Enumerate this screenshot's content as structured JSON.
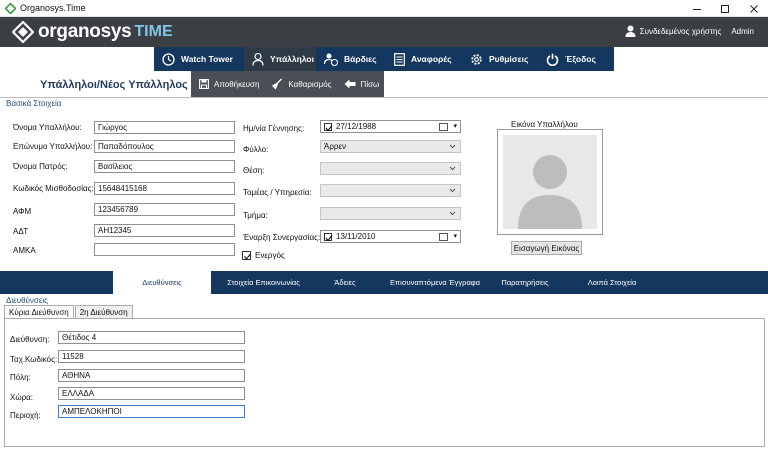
{
  "window": {
    "title": "Organosys.Time"
  },
  "header": {
    "logo_text": "organosys",
    "logo_suffix": "TIME",
    "user_label": "Συνδεδεμένος χρήστης",
    "user_name": "Admin"
  },
  "nav": {
    "items": [
      {
        "label": "Watch Tower",
        "icon": "clock-icon"
      },
      {
        "label": "Υπάλληλοι",
        "icon": "person-icon"
      },
      {
        "label": "Βάρδιες",
        "icon": "schedule-icon"
      },
      {
        "label": "Αναφορές",
        "icon": "report-icon"
      },
      {
        "label": "Ρυθμίσεις",
        "icon": "gear-icon"
      },
      {
        "label": "Έξοδος",
        "icon": "power-icon"
      }
    ]
  },
  "page": {
    "title": "Υπάλληλοι/Νέος Υπάλληλος",
    "toolbar": {
      "save": "Αποθήκευση",
      "clear": "Καθαρισμός",
      "back": "Πίσω"
    },
    "section_label": "Βασικά Στοιχεία"
  },
  "form": {
    "first_name": {
      "label": "Όνομα Υπαλλήλου:",
      "value": "Γιώργος"
    },
    "last_name": {
      "label": "Επώνυμο Υπαλλήλου:",
      "value": "Παπαδόπουλος"
    },
    "father_name": {
      "label": "Όνομα Πατρός:",
      "value": "Βασίλειος"
    },
    "payroll_code": {
      "label": "Κωδικός Μισθοδοσίας:",
      "value": "15648415168"
    },
    "afm": {
      "label": "ΑΦΜ",
      "value": "123456789"
    },
    "adt": {
      "label": "ΑΔΤ",
      "value": "ΑΗ12345"
    },
    "amka": {
      "label": "ΑΜΚΑ",
      "value": ""
    },
    "birth_date": {
      "label": "Ημ/νία Γέννησης:",
      "value": "27/12/1988"
    },
    "gender": {
      "label": "Φύλλο:",
      "value": "Άρρεν"
    },
    "position": {
      "label": "Θέση:",
      "value": ""
    },
    "sector": {
      "label": "Τομέας / Υπηρεσία:",
      "value": ""
    },
    "department": {
      "label": "Τμήμα:",
      "value": ""
    },
    "start_date": {
      "label": "Έναρξη Συνεργασίας:",
      "value": "13/11/2010"
    },
    "active_label": "Ενεργός",
    "photo_label": "Εικόνα Υπαλλήλου",
    "insert_image": "Εισαγωγή Εικόνας"
  },
  "tabs": {
    "items": [
      "Διευθύνσεις",
      "Στοιχεία Επικοινωνίας",
      "Άδειες",
      "Επισυναπτόμενα Έγγραφα",
      "Παρατηρήσεις",
      "Λοιπά Στοιχεία"
    ],
    "section_label": "Διευθύνσεις",
    "inner": [
      "Κύρια Διεύθυνση",
      "2η Διεύθυνση"
    ]
  },
  "address": {
    "street": {
      "label": "Διεύθυνση:",
      "value": "Θέτιδος 4"
    },
    "zip": {
      "label": "Ταχ.Κωδικός:",
      "value": "11528"
    },
    "city": {
      "label": "Πόλη:",
      "value": "ΑΘΗΝΑ"
    },
    "country": {
      "label": "Χώρα:",
      "value": "ΕΛΛΑΔΑ"
    },
    "area": {
      "label": "Περιοχή:",
      "value": "ΑΜΠΕΛΟΚΗΠΟΙ"
    }
  }
}
